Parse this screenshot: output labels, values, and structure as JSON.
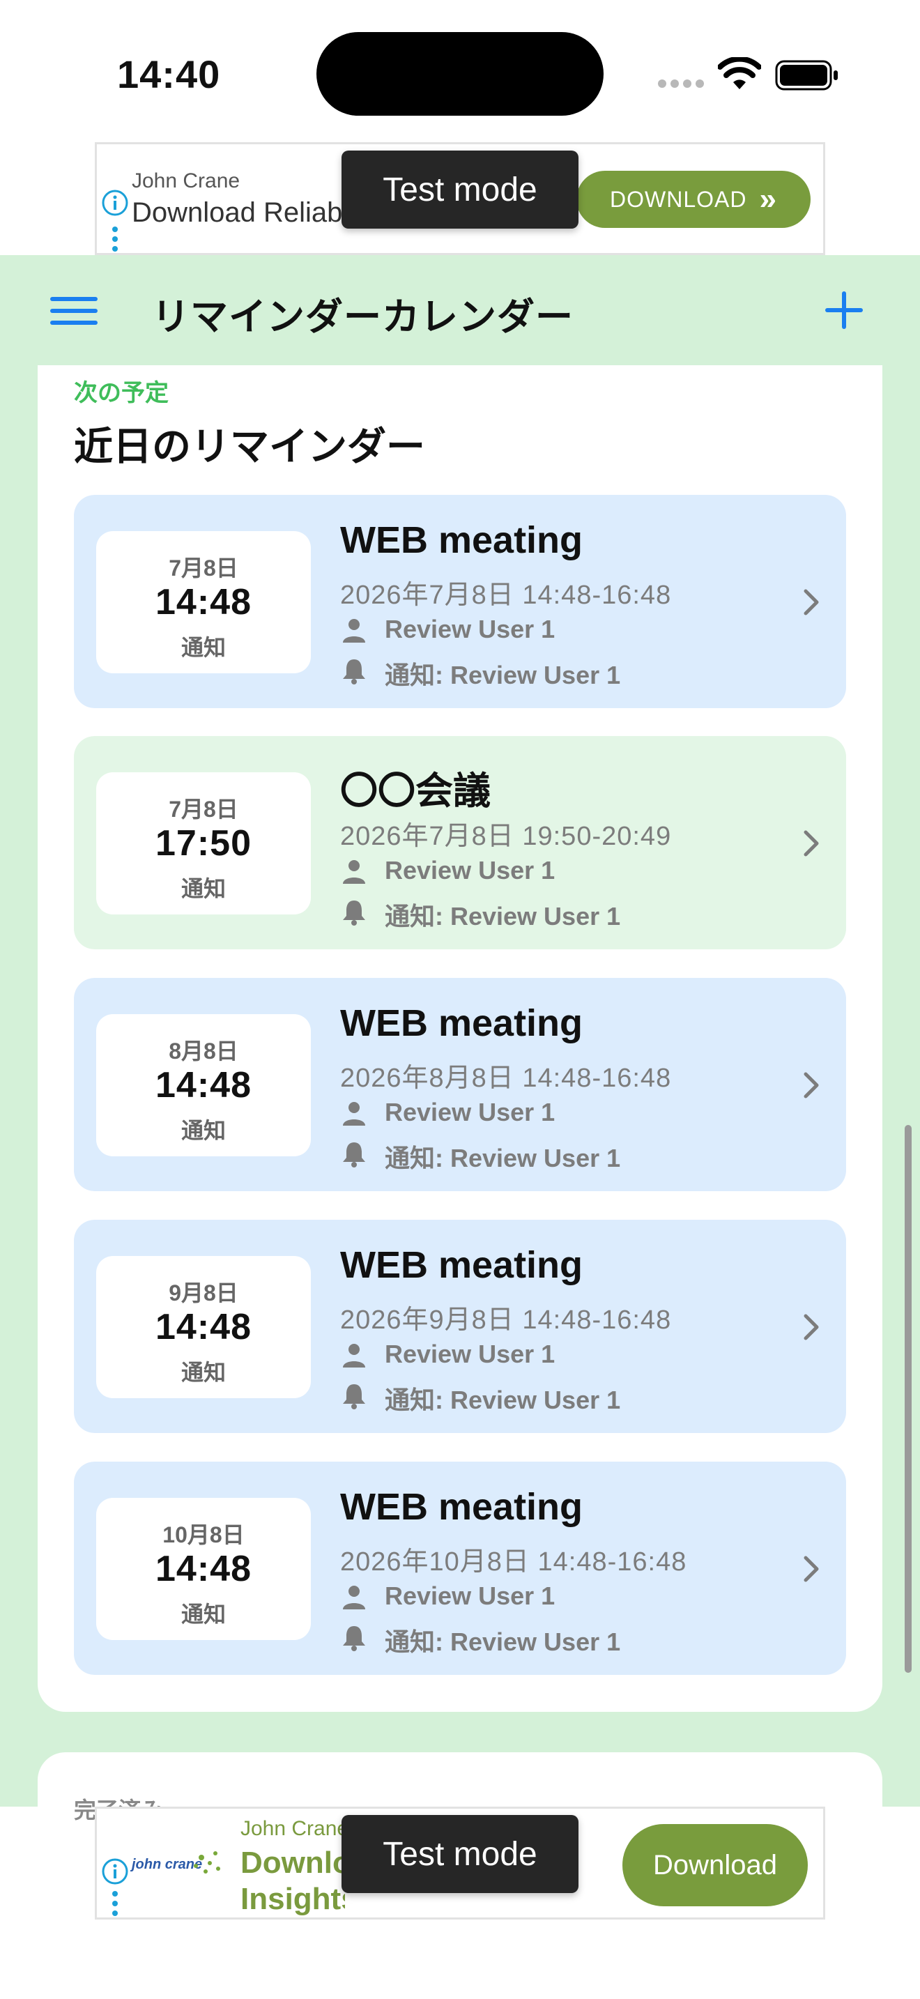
{
  "status_bar": {
    "time": "14:40"
  },
  "ad_top": {
    "advertiser": "John Crane",
    "headline": "Download Reliability",
    "button_label": "DOWNLOAD",
    "badge": "Test mode"
  },
  "header": {
    "title": "リマインダーカレンダー",
    "menu_icon": "hamburger-menu-icon",
    "add_icon": "plus-icon"
  },
  "upcoming": {
    "eyebrow": "次の予定",
    "title": "近日のリマインダー",
    "items": [
      {
        "date": "7月8日",
        "time": "14:48",
        "notify_label": "通知",
        "title": "WEB meating",
        "range": "2026年7月8日 14:48-16:48",
        "user": "Review User 1",
        "notify": "通知: Review User 1",
        "color": "#dcecfd"
      },
      {
        "date": "7月8日",
        "time": "17:50",
        "notify_label": "通知",
        "title": "〇〇会議",
        "range": "2026年7月8日 19:50-20:49",
        "user": "Review User 1",
        "notify": "通知: Review User 1",
        "color": "#e3f6e6"
      },
      {
        "date": "8月8日",
        "time": "14:48",
        "notify_label": "通知",
        "title": "WEB meating",
        "range": "2026年8月8日 14:48-16:48",
        "user": "Review User 1",
        "notify": "通知: Review User 1",
        "color": "#dcecfd"
      },
      {
        "date": "9月8日",
        "time": "14:48",
        "notify_label": "通知",
        "title": "WEB meating",
        "range": "2026年9月8日 14:48-16:48",
        "user": "Review User 1",
        "notify": "通知: Review User 1",
        "color": "#dcecfd"
      },
      {
        "date": "10月8日",
        "time": "14:48",
        "notify_label": "通知",
        "title": "WEB meating",
        "range": "2026年10月8日 14:48-16:48",
        "user": "Review User 1",
        "notify": "通知: Review User 1",
        "color": "#dcecfd"
      }
    ]
  },
  "completed": {
    "label": "完了済み"
  },
  "ad_bottom": {
    "advertiser": "John Crane",
    "headline": "Download Insights",
    "button_label": "Download",
    "badge": "Test mode",
    "logo_text": "john crane"
  },
  "colors": {
    "app_background": "#d4f1d8",
    "accent_blue": "#1a7ff0",
    "accent_green": "#3fbd5a",
    "ad_button": "#799c3d"
  }
}
